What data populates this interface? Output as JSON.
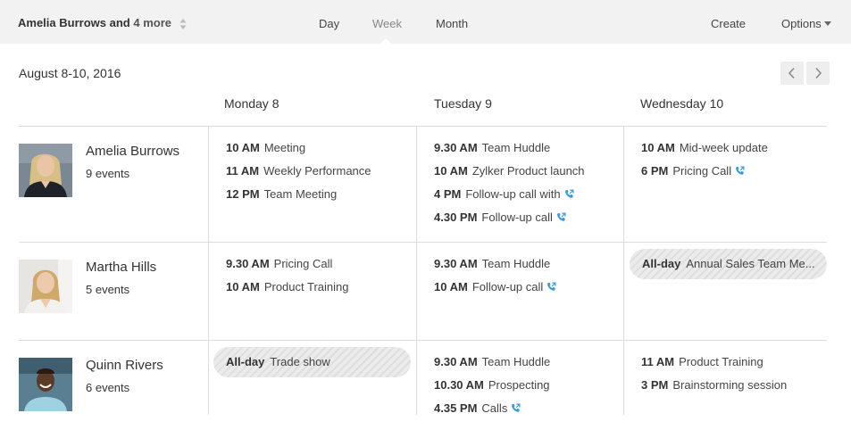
{
  "header": {
    "user_name": "Amelia Burrows",
    "user_and": "and",
    "user_more": "4 more",
    "tabs": [
      {
        "label": "Day"
      },
      {
        "label": "Week"
      },
      {
        "label": "Month"
      }
    ],
    "active_tab": "Week",
    "create_label": "Create",
    "options_label": "Options"
  },
  "calendar": {
    "date_range": "August 8-10, 2016",
    "days": [
      "Monday 8",
      "Tuesday 9",
      "Wednesday 10"
    ]
  },
  "people": [
    {
      "name": "Amelia Burrows",
      "events_count": "9 events",
      "days": [
        [
          {
            "time": "10 AM",
            "title": "Meeting"
          },
          {
            "time": "11 AM",
            "title": "Weekly Performance"
          },
          {
            "time": "12 PM",
            "title": "Team Meeting"
          }
        ],
        [
          {
            "time": "9.30 AM",
            "title": "Team Huddle"
          },
          {
            "time": "10 AM",
            "title": "Zylker Product launch"
          },
          {
            "time": "4 PM",
            "title": "Follow-up call with",
            "icon": "phone-icon"
          },
          {
            "time": "4.30 PM",
            "title": "Follow-up call",
            "icon": "phone-icon"
          }
        ],
        [
          {
            "time": "10 AM",
            "title": "Mid-week update"
          },
          {
            "time": "6 PM",
            "title": "Pricing Call",
            "icon": "phone-icon"
          }
        ]
      ]
    },
    {
      "name": "Martha Hills",
      "events_count": "5 events",
      "days": [
        [
          {
            "time": "9.30 AM",
            "title": "Pricing Call"
          },
          {
            "time": "10 AM",
            "title": "Product Training"
          }
        ],
        [
          {
            "time": "9.30 AM",
            "title": "Team Huddle"
          },
          {
            "time": "10 AM",
            "title": "Follow-up call",
            "icon": "phone-icon"
          }
        ],
        [
          {
            "time": "All-day",
            "title": "Annual Sales Team Me...",
            "allday": true
          }
        ]
      ]
    },
    {
      "name": "Quinn Rivers",
      "events_count": "6 events",
      "days": [
        [
          {
            "time": "All-day",
            "title": "Trade show",
            "allday": true
          }
        ],
        [
          {
            "time": "9.30 AM",
            "title": "Team Huddle"
          },
          {
            "time": "10.30 AM",
            "title": "Prospecting"
          },
          {
            "time": "4.35 PM",
            "title": "Calls",
            "icon": "phone-icon"
          }
        ],
        [
          {
            "time": "11 AM",
            "title": "Product Training"
          },
          {
            "time": "3 PM",
            "title": "Brainstorming session"
          }
        ]
      ]
    }
  ],
  "colors": {
    "accent_phone": "#3a9ad9",
    "topbar_bg": "#f2f2f2",
    "allday_bg": "#e6e6e6"
  }
}
